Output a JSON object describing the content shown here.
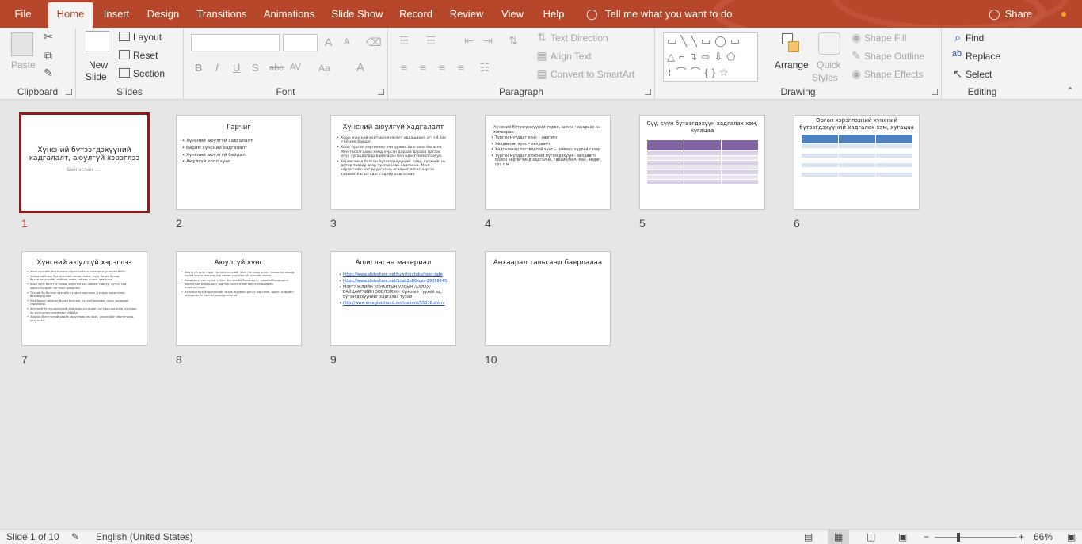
{
  "tabs": [
    "File",
    "Home",
    "Insert",
    "Design",
    "Transitions",
    "Animations",
    "Slide Show",
    "Record",
    "Review",
    "View",
    "Help"
  ],
  "tell_me": "Tell me what you want to do",
  "share": "Share",
  "ribbon": {
    "clipboard": {
      "label": "Clipboard",
      "paste": "Paste"
    },
    "slides": {
      "label": "Slides",
      "new_slide_1": "New",
      "new_slide_2": "Slide",
      "layout": "Layout",
      "reset": "Reset",
      "section": "Section"
    },
    "font": {
      "label": "Font",
      "bold": "B",
      "italic": "I",
      "underline": "U",
      "shadow": "S",
      "strike": "abc",
      "spacing": "AV",
      "case": "Aa",
      "color": "A",
      "grow": "A",
      "shrink": "A"
    },
    "paragraph": {
      "label": "Paragraph",
      "text_direction": "Text Direction",
      "align_text": "Align Text",
      "smartart": "Convert to SmartArt"
    },
    "drawing": {
      "label": "Drawing",
      "arrange": "Arrange",
      "quick_styles_1": "Quick",
      "quick_styles_2": "Styles",
      "fill": "Shape Fill",
      "outline": "Shape Outline",
      "effects": "Shape Effects"
    },
    "editing": {
      "label": "Editing",
      "find": "Find",
      "replace": "Replace",
      "select": "Select"
    }
  },
  "slides": [
    {
      "num": "1",
      "title": "Хүнсний бүтээгдэхүүний хадгалалт, аюулгүй хэрэглээ",
      "subtitle": "Байгаслан ....."
    },
    {
      "num": "2",
      "title": "Гарчиг",
      "bullets": [
        "Хүнсний аюулгүй хадгалалт",
        "Барим хүнсний хадгалалт",
        "Хүнсний аюулгүй байдал",
        "Аюулгүй хоол хүнс"
      ]
    },
    {
      "num": "3",
      "title": "Хүнсний аюулгүй хадгалалт",
      "bullets": [
        "Хоол, хүнсний хүйтэд нян өсөлт удааширна уг: +4 бас +60 хэм байдаг.",
        "Хоол турган хөргөхөөр нян үржих болгохоо багасна. Мен тасалгааны хэмд хүрсэн дарааа дараах цагаас илүү хугацаагаар байлгасан бол идэхгүй болгоогуй.",
        "Хөргөгчинд болсон бүтээгдэхүүнийг давр, гүүжийг нь дотор таваар дээр тусгаарлан хадгална. Мен хөргөгчийн хэт дүүргэх нь агаарыг ялгаг хэргэх хэлхийг багасгадаг гадуйр хадгалнаа."
      ]
    },
    {
      "num": "4",
      "title": "Хүнсний бүтээгдэхүүний төрөл, шинж чанараас нь хамаарах:",
      "bullets": [
        "Түргэн мууддаг хүнс – хөргөгч",
        "Хөлдөөсөн хүнс – хөлдөөгч",
        "Хадгалахад тогтвортой хүнс – цайвар, хуурай газар",
        "Түргэн мууддаг хүнсний бүтээгдэхүүн – хөлдөөгч болон хөргөгчинд хадгална. гахайн/бал- мах, өндөг, сүү г.м"
      ]
    },
    {
      "num": "5",
      "title": "Сүү, сүүн бүтээгдэхүүн хадгалах хэм, хугацаа"
    },
    {
      "num": "6",
      "title": "Өргөн хэрэглээний хүнсний бүтээгдэхүүний хадгалах хэм, хугацаа"
    },
    {
      "num": "7",
      "title": "Хүнсний аюулгүй хэрэглээ",
      "bullets": [
        "Хоол хүнсийг бэлтгэхдээ гараа сайтар савандаж угаасан байх",
        "Хоолд хийгдэх бүх хүнсний ногоо, жимс, хүнс болох бусад бүтээгдэхүүнийг хийхээс өмнө сайтар угааж цэвэрлэх.",
        "Хоол хүнс бэлтгэх газар, хэрэглэгдэх ширээ, тавиур, хутга, сав, хэрэгслүүдийг тогтмол цэвэрлэх.",
        "Түүхий ба болсон хүнсийг тусдаа хадгалах, тусдаа хэрэгслээр боловсруулах.",
        "Мах болон загасыг бүрэн болгож, түүхий махнаас шүүс дусахаас сэргийлэх.",
        "Хүнсний бүтээгдэхүүний хадгалах хугацааг тогтмол шалгаж, хугацаа нь дууссаныг хэрэглэхгүй байх.",
        "Хоолоо бэлтгэсний дараа халуунаар нь идэх, үлдсэнийг хөргөгчинд хадгалах."
      ]
    },
    {
      "num": "8",
      "title": "Аюулгүй хүнс",
      "bullets": [
        "Аюулгүй хүнс гэдэг нь хоол хүнсийг бэлтгэх, хадгалах, тээвэрлэх явцад хүний эрүүл мэндэд хор нөлөө үзүүлэхгүй хүнсийг хэлнэ.",
        "Бохирдлуулах хүчин зүйлс: Физикийн бохирдолт, химийн бохирдолт, биологийн бохирдолт, эдгээр нь хүнсний аюулгүй байдлыг алдагдуулдаг.",
        "Хүнсний бүтээгдэхүүнийг зохих журмын дагуу хадгалж, ариун цэврийн шаардлагыг хангах шаардлагатай."
      ]
    },
    {
      "num": "9",
      "title": "Ашигласан материал",
      "links": [
        "https://www.slideshare.net/tuwshuutuku/food-safe",
        "https://www.slideshare.net/Scab2oRGo/ss-29059245"
      ],
      "bullets": [
        "МЭРГЭЖЛИЙН ХЯНАЛТЫН УЛСЫН /АХЛАХ/ БАЙЦААГЧИЙН ЗӨВЛӨМЖ - Хүнсний түүхий эд, бүтээгдэхүүнийг хадгалах тухай"
      ],
      "link3": "http://www.emegteichuud.mn/content/55038.shtml"
    },
    {
      "num": "10",
      "title": "Анхаарал тавьсанд баярлалаа"
    }
  ],
  "status": {
    "slide_count": "Slide 1 of 10",
    "language": "English (United States)",
    "zoom": "66%"
  }
}
